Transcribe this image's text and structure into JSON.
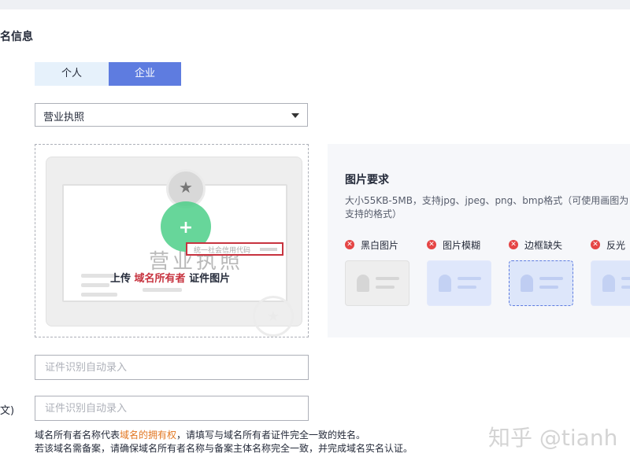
{
  "section": {
    "title": "名信息"
  },
  "owner_type": {
    "options": [
      "个人",
      "企业"
    ],
    "selected": "企业"
  },
  "certificate_select": {
    "value": "营业执照"
  },
  "upload": {
    "license_text": "营业执照",
    "credit_code_label": "统一社会信用代码",
    "caption_prefix": "上传",
    "caption_highlight": "域名所有者",
    "caption_suffix": "证件图片"
  },
  "requirements": {
    "title": "图片要求",
    "description": "大小55KB-5MB，支持jpg、jpeg、png、bmp格式（可使用画图为支持的格式）",
    "items": [
      {
        "label": "黑白图片",
        "bg": "#eeeeee",
        "border": "#e0e0e0",
        "fg": "#d6d6d6"
      },
      {
        "label": "图片模糊",
        "bg": "#dfe7fb",
        "border": "#e3e9fb",
        "fg": "#c3d1f3"
      },
      {
        "label": "边框缺失",
        "bg": "#dde6fa",
        "border": "#5e7ce0",
        "fg": "#bfcdf2"
      },
      {
        "label": "反光",
        "bg": "#dde6fa",
        "border": "#e3e9fb",
        "fg": "#c3d1f3"
      }
    ]
  },
  "fields": {
    "name_cn": {
      "placeholder": "证件识别自动录入",
      "value": ""
    },
    "name_en": {
      "label": "文)",
      "placeholder": "证件识别自动录入",
      "value": ""
    }
  },
  "hint": {
    "line1_prefix": "域名所有者名称代表",
    "line1_highlight": "域名的拥有权",
    "line1_suffix": "，请填写与域名所有者证件完全一致的姓名。",
    "line2": "若该域名需备案，请确保域名所有者名称与备案主体名称完全一致，并完成域名实名认证。"
  },
  "watermark": "知乎 @tianh"
}
